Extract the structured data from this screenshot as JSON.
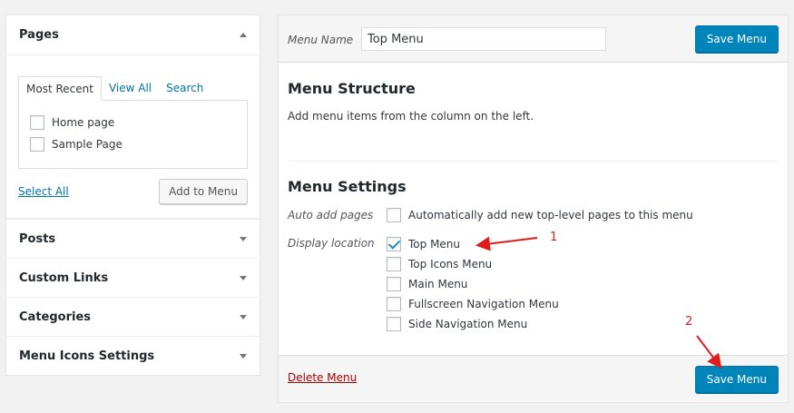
{
  "left_panel": {
    "pages_title": "Pages",
    "tabs": [
      "Most Recent",
      "View All",
      "Search"
    ],
    "pages": [
      {
        "label": "Home page",
        "checked": false
      },
      {
        "label": "Sample Page",
        "checked": false
      }
    ],
    "select_all": "Select All",
    "add_to_menu": "Add to Menu",
    "sections": [
      "Posts",
      "Custom Links",
      "Categories",
      "Menu Icons Settings"
    ]
  },
  "menu_header": {
    "name_label": "Menu Name",
    "name_value": "Top Menu",
    "save_label": "Save Menu"
  },
  "structure": {
    "title": "Menu Structure",
    "description": "Add menu items from the column on the left."
  },
  "settings": {
    "title": "Menu Settings",
    "auto_add_label": "Auto add pages",
    "auto_add_option": "Automatically add new top-level pages to this menu",
    "display_location_label": "Display location",
    "locations": [
      {
        "label": "Top Menu",
        "checked": true
      },
      {
        "label": "Top Icons Menu",
        "checked": false
      },
      {
        "label": "Main Menu",
        "checked": false
      },
      {
        "label": "Fullscreen Navigation Menu",
        "checked": false
      },
      {
        "label": "Side Navigation Menu",
        "checked": false
      }
    ]
  },
  "footer": {
    "delete_label": "Delete Menu",
    "save_label": "Save Menu"
  },
  "annotations": {
    "step1": "1",
    "step2": "2",
    "color": "#e01b1b"
  },
  "colors": {
    "primary": "#0085ba",
    "link": "#0073aa",
    "delete": "#aa0000"
  }
}
